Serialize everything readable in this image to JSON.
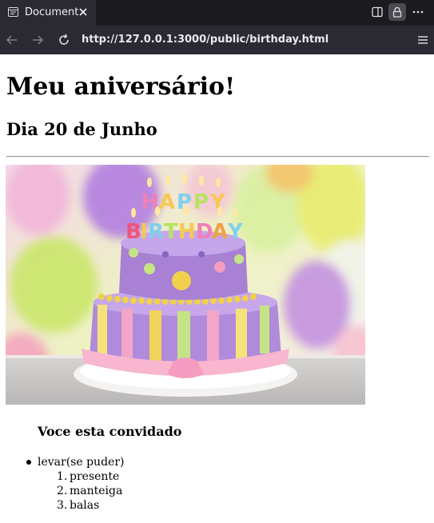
{
  "tab": {
    "title": "Document"
  },
  "toolbar": {
    "icons": [
      "split-view-icon",
      "lock-icon",
      "more-icon"
    ]
  },
  "navigation": {
    "url": "http://127.0.0.1:3000/public/birthday.html",
    "icons": [
      "back-arrow-icon",
      "forward-arrow-icon",
      "reload-icon",
      "hamburger-menu-icon"
    ]
  },
  "page": {
    "heading": "Meu aniversário!",
    "date": "Dia 20 de Junho",
    "cake_image": {
      "candle_text": "HAPPY BIRTHDAY"
    },
    "invite": "Voce esta convidado",
    "list": {
      "item": "levar(se puder)",
      "subitems": [
        {
          "number": "1.",
          "text": "presente"
        },
        {
          "number": "2.",
          "text": "manteiga"
        },
        {
          "number": "3.",
          "text": "balas"
        }
      ]
    }
  },
  "colors": {
    "tabbar_bg": "#1b1b1f",
    "toolbar_bg": "#2b2a33",
    "page_bg": "#ffffff"
  }
}
